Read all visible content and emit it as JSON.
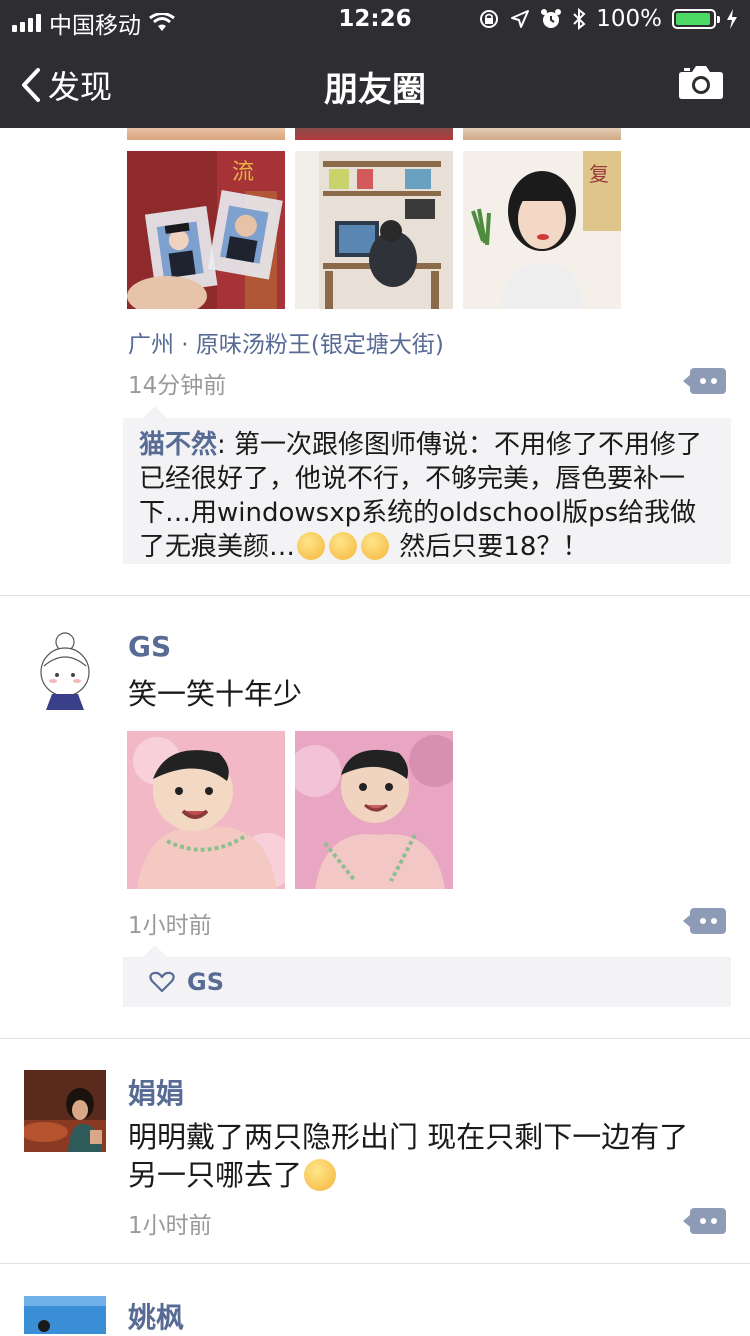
{
  "status": {
    "carrier": "中国移动",
    "time": "12:26",
    "battery": "100%",
    "battery_level": 1.0
  },
  "nav": {
    "back_label": "发现",
    "title": "朋友圈"
  },
  "posts": [
    {
      "location": "广州 · 原味汤粉王(银定塘大街)",
      "time": "14分钟前",
      "comment": {
        "author": "猫不然",
        "text": ": 第一次跟修图师傳说：不用修了不用修了已经很好了，他说不行，不够完美，唇色要补一下…用windowsxp系统的oldschool版ps给我做了无痕美颜…",
        "emoji": [
          "flushed-emoji",
          "flushed-emoji",
          "flushed-emoji"
        ],
        "tail": " 然后只要18？！"
      }
    },
    {
      "name": "GS",
      "text": "笑一笑十年少",
      "time": "1小时前",
      "likes": [
        "GS"
      ]
    },
    {
      "name": "娟娟",
      "text": "明明戴了两只隐形出门 现在只剩下一边有了 另一只哪去了",
      "emoji": "crying-emoji",
      "time": "1小时前"
    },
    {
      "name": "姚枫"
    }
  ],
  "colors": {
    "topbar": "#2e2d32",
    "name": "#576b95",
    "timestamp": "#9a9a9a",
    "comment_bg": "#f3f3f5",
    "battery": "#4cd964"
  }
}
